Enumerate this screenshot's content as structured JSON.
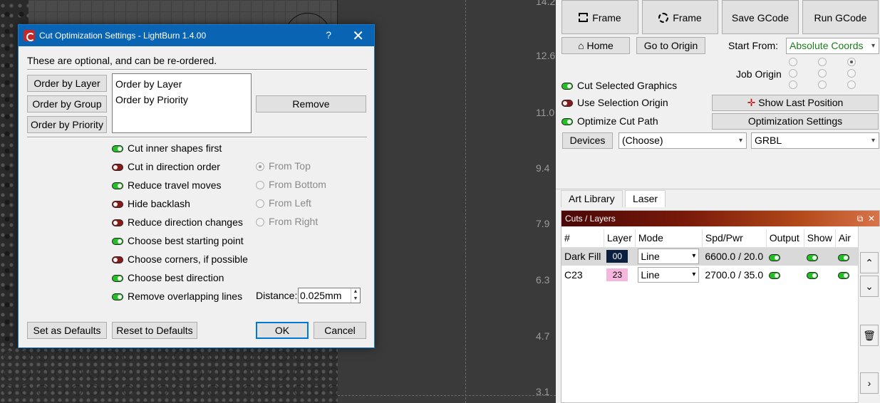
{
  "canvas": {
    "ruler_labels": [
      {
        "value": "14.2"
      },
      {
        "value": "12.6"
      },
      {
        "value": "11.0"
      },
      {
        "value": "9.4"
      },
      {
        "value": "7.9"
      },
      {
        "value": "6.3"
      },
      {
        "value": "4.7"
      },
      {
        "value": "3.1"
      }
    ]
  },
  "dialog": {
    "title": "Cut Optimization Settings - LightBurn 1.4.00",
    "help_label": "?",
    "close_label": "✕",
    "intro": "These are optional, and can be re-ordered.",
    "order_buttons": [
      "Order by Layer",
      "Order by Group",
      "Order by Priority"
    ],
    "order_list": [
      "Order by Layer",
      "Order by Priority"
    ],
    "remove_label": "Remove",
    "options": [
      {
        "label": "Cut inner shapes first",
        "state": "on"
      },
      {
        "label": "Cut in direction order",
        "state": "off"
      },
      {
        "label": "Reduce travel moves",
        "state": "on"
      },
      {
        "label": "Hide backlash",
        "state": "off"
      },
      {
        "label": "Reduce direction changes",
        "state": "off"
      },
      {
        "label": "Choose best starting point",
        "state": "on"
      },
      {
        "label": "Choose corners, if possible",
        "state": "off"
      },
      {
        "label": "Choose best direction",
        "state": "on"
      },
      {
        "label": "Remove overlapping lines",
        "state": "on"
      }
    ],
    "direction_options": [
      {
        "label": "From Top",
        "checked": true
      },
      {
        "label": "From Bottom",
        "checked": false
      },
      {
        "label": "From Left",
        "checked": false
      },
      {
        "label": "From Right",
        "checked": false
      }
    ],
    "distance_label": "Distance:",
    "distance_value": "0.025mm",
    "set_defaults_label": "Set as Defaults",
    "reset_defaults_label": "Reset to Defaults",
    "ok_label": "OK",
    "cancel_label": "Cancel"
  },
  "right_panel": {
    "frame1_label": "Frame",
    "frame2_label": "Frame",
    "save_gcode_label": "Save GCode",
    "run_gcode_label": "Run GCode",
    "home_label": "Home",
    "go_origin_label": "Go to Origin",
    "start_from_label": "Start From:",
    "start_from_value": "Absolute Coords",
    "job_origin_label": "Job Origin",
    "cut_selected_label": "Cut Selected Graphics",
    "use_selection_origin_label": "Use Selection Origin",
    "optimize_cut_path_label": "Optimize Cut Path",
    "show_last_position_label": "Show Last Position",
    "optimization_settings_label": "Optimization Settings",
    "devices_label": "Devices",
    "device_value": "(Choose)",
    "controller_value": "GRBL",
    "tabs": [
      "Art Library",
      "Laser"
    ],
    "cuts_title": "Cuts / Layers",
    "columns": [
      "#",
      "Layer",
      "Mode",
      "Spd/Pwr",
      "Output",
      "Show",
      "Air"
    ],
    "layers": [
      {
        "name": "Dark Fill",
        "layer": "00",
        "color": "#0b1f3f",
        "text_color": "#ffffff",
        "mode": "Line",
        "spdpwr": "6600.0 / 20.0"
      },
      {
        "name": "C23",
        "layer": "23",
        "color": "#f4b6dc",
        "text_color": "#000000",
        "mode": "Line",
        "spdpwr": "2700.0 / 35.0"
      }
    ]
  },
  "colors": {
    "toggle_on": "#22c022",
    "toggle_off": "#8b1a1a",
    "title_bar": "#0a64b4",
    "start_from_text": "#1a7f1a"
  }
}
